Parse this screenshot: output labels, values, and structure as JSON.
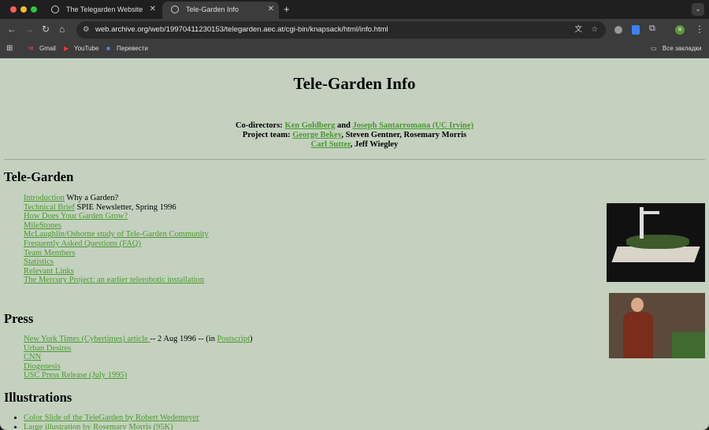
{
  "browser": {
    "tabs": [
      {
        "title": "The Telegarden Website"
      },
      {
        "title": "Tele-Garden Info"
      }
    ],
    "url": "web.archive.org/web/19970411230153/telegarden.aec.at/cgi-bin/knapsack/html/info.html",
    "bookmarks": [
      "Gmail",
      "YouTube",
      "Перевести"
    ],
    "all_bookmarks": "Все закладки",
    "profile_initial": "a"
  },
  "page": {
    "title": "Tele-Garden Info",
    "credits": {
      "codirectors_label": "Co-directors:",
      "ken": "Ken Goldberg",
      "and": "and",
      "joseph": "Joseph Santarromana (UC Irvine)",
      "team_label": "Project team:",
      "george": "George Bekey",
      "team_rest": ", Steven Gentner, Rosemary Morris",
      "carl": "Carl Sutter",
      "jeff": ", Jeff Wiegley"
    },
    "telegarden": {
      "heading": "Tele-Garden",
      "items": [
        {
          "link": "Introduction",
          "text": " Why a Garden?"
        },
        {
          "link": "Technical Brief",
          "text": " SPIE Newsletter, Spring 1996"
        },
        {
          "link": "How Does Your Garden Grow?",
          "text": ""
        },
        {
          "link": "MileStones",
          "text": ""
        },
        {
          "link": "McLaughlin/Osborne study of Tele-Garden Community",
          "text": ""
        },
        {
          "link": "Frequently Asked Questions (FAQ)",
          "text": ""
        },
        {
          "link": "Team Members",
          "text": ""
        },
        {
          "link": "Statistics",
          "text": ""
        },
        {
          "link": "Relevant Links",
          "text": ""
        },
        {
          "link": "The Mercury Project: an earlier telerobotic installation",
          "text": ""
        }
      ]
    },
    "press": {
      "heading": "Press",
      "nyt": "New York Times (Cybertimes) article ",
      "nyt_text": "-- 2 Aug 1996 -- (in ",
      "postscript": "Postscript",
      "close": ")",
      "items": [
        "Urban Desires",
        "CNN",
        "Diogenesis",
        "USC Press Release (July 1995)"
      ]
    },
    "illustrations": {
      "heading": "Illustrations",
      "items": [
        "Color Slide of the TeleGarden by Robert Wedemeyer",
        "Large illustration by Rosemary Morris (95K)"
      ]
    }
  }
}
